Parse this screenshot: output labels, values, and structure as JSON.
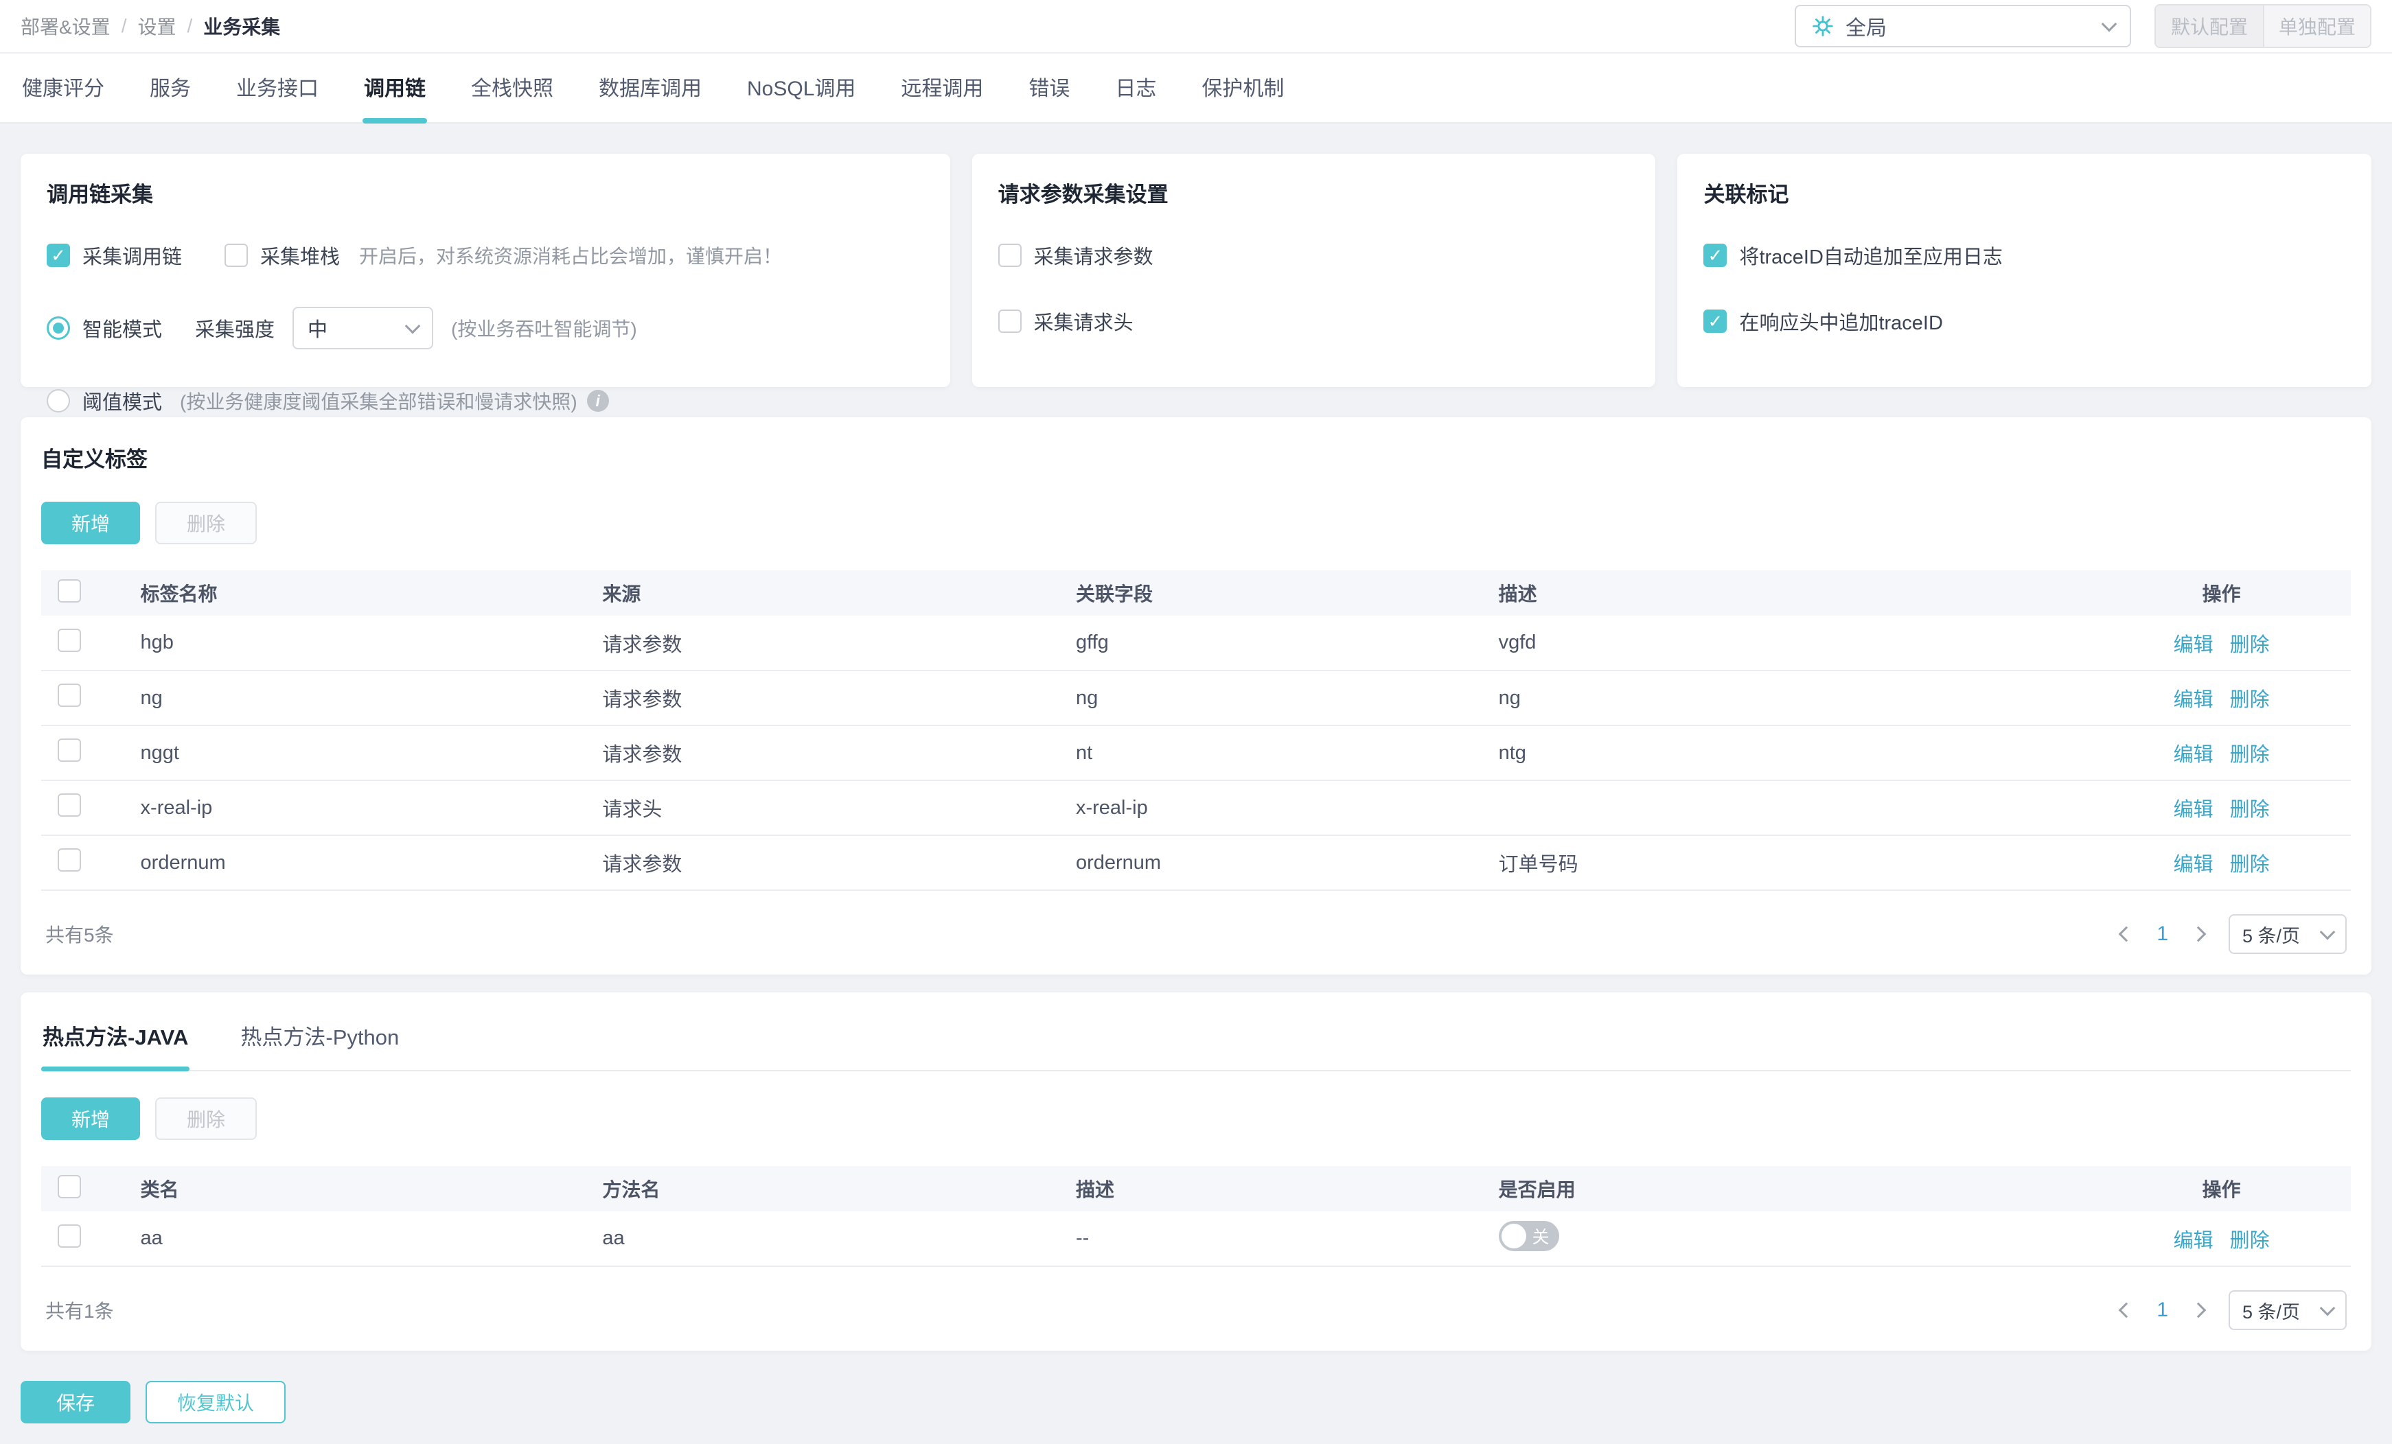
{
  "colors": {
    "accent": "#4FC6D0",
    "link": "#3AA6C8",
    "toggle_off": "#C2C6CD",
    "page_number": "#3A9FD3"
  },
  "breadcrumb": {
    "separator": "/",
    "items": [
      "部署&设置",
      "设置",
      "业务采集"
    ]
  },
  "header_controls": {
    "scope_select": {
      "icon": "gear-icon",
      "value": "全局"
    },
    "default_config_label": "默认配置",
    "separate_config_label": "单独配置"
  },
  "tabs": {
    "active": "调用链",
    "items": [
      "健康评分",
      "服务",
      "业务接口",
      "调用链",
      "全栈快照",
      "数据库调用",
      "NoSQL调用",
      "远程调用",
      "错误",
      "日志",
      "保护机制"
    ]
  },
  "cards": {
    "trace_collection": {
      "title": "调用链采集",
      "collect_trace": {
        "label": "采集调用链",
        "checked": true
      },
      "collect_stack": {
        "label": "采集堆栈",
        "checked": false
      },
      "stack_warning": "开启后，对系统资源消耗占比会增加，谨慎开启！",
      "smart_mode": {
        "label": "智能模式",
        "selected": true
      },
      "intensity_label": "采集强度",
      "intensity_value": "中",
      "smart_hint": "(按业务吞吐智能调节)",
      "threshold_mode": {
        "label": "阈值模式",
        "selected": false
      },
      "threshold_hint": "(按业务健康度阈值采集全部错误和慢请求快照)",
      "info_glyph": "i"
    },
    "request_params": {
      "title": "请求参数采集设置",
      "collect_params": {
        "label": "采集请求参数",
        "checked": false
      },
      "collect_headers": {
        "label": "采集请求头",
        "checked": false
      }
    },
    "correlation": {
      "title": "关联标记",
      "append_trace_to_log": {
        "label": "将traceID自动追加至应用日志",
        "checked": true
      },
      "append_trace_to_header": {
        "label": "在响应头中追加traceID",
        "checked": true
      }
    }
  },
  "custom_tags": {
    "title": "自定义标签",
    "add_label": "新增",
    "delete_label": "删除",
    "columns": {
      "name": "标签名称",
      "source": "来源",
      "field": "关联字段",
      "desc": "描述",
      "action": "操作"
    },
    "actions": {
      "edit": "编辑",
      "delete": "删除"
    },
    "rows": [
      {
        "name": "hgb",
        "source": "请求参数",
        "field": "gffg",
        "desc": "vgfd"
      },
      {
        "name": "ng",
        "source": "请求参数",
        "field": "ng",
        "desc": "ng"
      },
      {
        "name": "nggt",
        "source": "请求参数",
        "field": "nt",
        "desc": "ntg"
      },
      {
        "name": "x-real-ip",
        "source": "请求头",
        "field": "x-real-ip",
        "desc": ""
      },
      {
        "name": "ordernum",
        "source": "请求参数",
        "field": "ordernum",
        "desc": "订单号码"
      }
    ],
    "total_text": "共有5条",
    "pagination": {
      "current": "1",
      "page_size": "5 条/页"
    }
  },
  "hot_methods": {
    "active_tab": "热点方法-JAVA",
    "tabs": [
      "热点方法-JAVA",
      "热点方法-Python"
    ],
    "add_label": "新增",
    "delete_label": "删除",
    "columns": {
      "class_name": "类名",
      "method": "方法名",
      "desc": "描述",
      "enabled": "是否启用",
      "action": "操作"
    },
    "actions": {
      "edit": "编辑",
      "delete": "删除"
    },
    "rows": [
      {
        "class_name": "aa",
        "method": "aa",
        "desc": "--",
        "enabled": false,
        "toggle_label": "关"
      }
    ],
    "total_text": "共有1条",
    "pagination": {
      "current": "1",
      "page_size": "5 条/页"
    }
  },
  "footer": {
    "save_label": "保存",
    "reset_label": "恢复默认"
  }
}
